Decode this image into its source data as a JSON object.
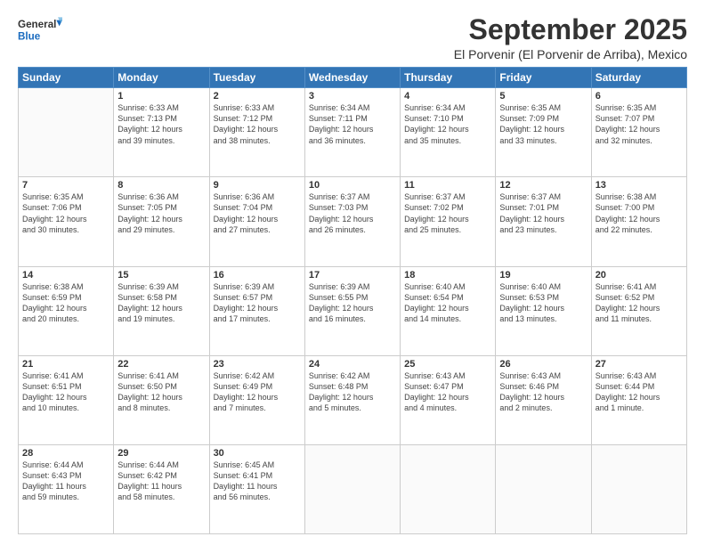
{
  "header": {
    "logo_general": "General",
    "logo_blue": "Blue",
    "month_title": "September 2025",
    "subtitle": "El Porvenir (El Porvenir de Arriba), Mexico"
  },
  "weekdays": [
    "Sunday",
    "Monday",
    "Tuesday",
    "Wednesday",
    "Thursday",
    "Friday",
    "Saturday"
  ],
  "weeks": [
    [
      {
        "day": "",
        "info": ""
      },
      {
        "day": "1",
        "info": "Sunrise: 6:33 AM\nSunset: 7:13 PM\nDaylight: 12 hours\nand 39 minutes."
      },
      {
        "day": "2",
        "info": "Sunrise: 6:33 AM\nSunset: 7:12 PM\nDaylight: 12 hours\nand 38 minutes."
      },
      {
        "day": "3",
        "info": "Sunrise: 6:34 AM\nSunset: 7:11 PM\nDaylight: 12 hours\nand 36 minutes."
      },
      {
        "day": "4",
        "info": "Sunrise: 6:34 AM\nSunset: 7:10 PM\nDaylight: 12 hours\nand 35 minutes."
      },
      {
        "day": "5",
        "info": "Sunrise: 6:35 AM\nSunset: 7:09 PM\nDaylight: 12 hours\nand 33 minutes."
      },
      {
        "day": "6",
        "info": "Sunrise: 6:35 AM\nSunset: 7:07 PM\nDaylight: 12 hours\nand 32 minutes."
      }
    ],
    [
      {
        "day": "7",
        "info": "Sunrise: 6:35 AM\nSunset: 7:06 PM\nDaylight: 12 hours\nand 30 minutes."
      },
      {
        "day": "8",
        "info": "Sunrise: 6:36 AM\nSunset: 7:05 PM\nDaylight: 12 hours\nand 29 minutes."
      },
      {
        "day": "9",
        "info": "Sunrise: 6:36 AM\nSunset: 7:04 PM\nDaylight: 12 hours\nand 27 minutes."
      },
      {
        "day": "10",
        "info": "Sunrise: 6:37 AM\nSunset: 7:03 PM\nDaylight: 12 hours\nand 26 minutes."
      },
      {
        "day": "11",
        "info": "Sunrise: 6:37 AM\nSunset: 7:02 PM\nDaylight: 12 hours\nand 25 minutes."
      },
      {
        "day": "12",
        "info": "Sunrise: 6:37 AM\nSunset: 7:01 PM\nDaylight: 12 hours\nand 23 minutes."
      },
      {
        "day": "13",
        "info": "Sunrise: 6:38 AM\nSunset: 7:00 PM\nDaylight: 12 hours\nand 22 minutes."
      }
    ],
    [
      {
        "day": "14",
        "info": "Sunrise: 6:38 AM\nSunset: 6:59 PM\nDaylight: 12 hours\nand 20 minutes."
      },
      {
        "day": "15",
        "info": "Sunrise: 6:39 AM\nSunset: 6:58 PM\nDaylight: 12 hours\nand 19 minutes."
      },
      {
        "day": "16",
        "info": "Sunrise: 6:39 AM\nSunset: 6:57 PM\nDaylight: 12 hours\nand 17 minutes."
      },
      {
        "day": "17",
        "info": "Sunrise: 6:39 AM\nSunset: 6:55 PM\nDaylight: 12 hours\nand 16 minutes."
      },
      {
        "day": "18",
        "info": "Sunrise: 6:40 AM\nSunset: 6:54 PM\nDaylight: 12 hours\nand 14 minutes."
      },
      {
        "day": "19",
        "info": "Sunrise: 6:40 AM\nSunset: 6:53 PM\nDaylight: 12 hours\nand 13 minutes."
      },
      {
        "day": "20",
        "info": "Sunrise: 6:41 AM\nSunset: 6:52 PM\nDaylight: 12 hours\nand 11 minutes."
      }
    ],
    [
      {
        "day": "21",
        "info": "Sunrise: 6:41 AM\nSunset: 6:51 PM\nDaylight: 12 hours\nand 10 minutes."
      },
      {
        "day": "22",
        "info": "Sunrise: 6:41 AM\nSunset: 6:50 PM\nDaylight: 12 hours\nand 8 minutes."
      },
      {
        "day": "23",
        "info": "Sunrise: 6:42 AM\nSunset: 6:49 PM\nDaylight: 12 hours\nand 7 minutes."
      },
      {
        "day": "24",
        "info": "Sunrise: 6:42 AM\nSunset: 6:48 PM\nDaylight: 12 hours\nand 5 minutes."
      },
      {
        "day": "25",
        "info": "Sunrise: 6:43 AM\nSunset: 6:47 PM\nDaylight: 12 hours\nand 4 minutes."
      },
      {
        "day": "26",
        "info": "Sunrise: 6:43 AM\nSunset: 6:46 PM\nDaylight: 12 hours\nand 2 minutes."
      },
      {
        "day": "27",
        "info": "Sunrise: 6:43 AM\nSunset: 6:44 PM\nDaylight: 12 hours\nand 1 minute."
      }
    ],
    [
      {
        "day": "28",
        "info": "Sunrise: 6:44 AM\nSunset: 6:43 PM\nDaylight: 11 hours\nand 59 minutes."
      },
      {
        "day": "29",
        "info": "Sunrise: 6:44 AM\nSunset: 6:42 PM\nDaylight: 11 hours\nand 58 minutes."
      },
      {
        "day": "30",
        "info": "Sunrise: 6:45 AM\nSunset: 6:41 PM\nDaylight: 11 hours\nand 56 minutes."
      },
      {
        "day": "",
        "info": ""
      },
      {
        "day": "",
        "info": ""
      },
      {
        "day": "",
        "info": ""
      },
      {
        "day": "",
        "info": ""
      }
    ]
  ]
}
